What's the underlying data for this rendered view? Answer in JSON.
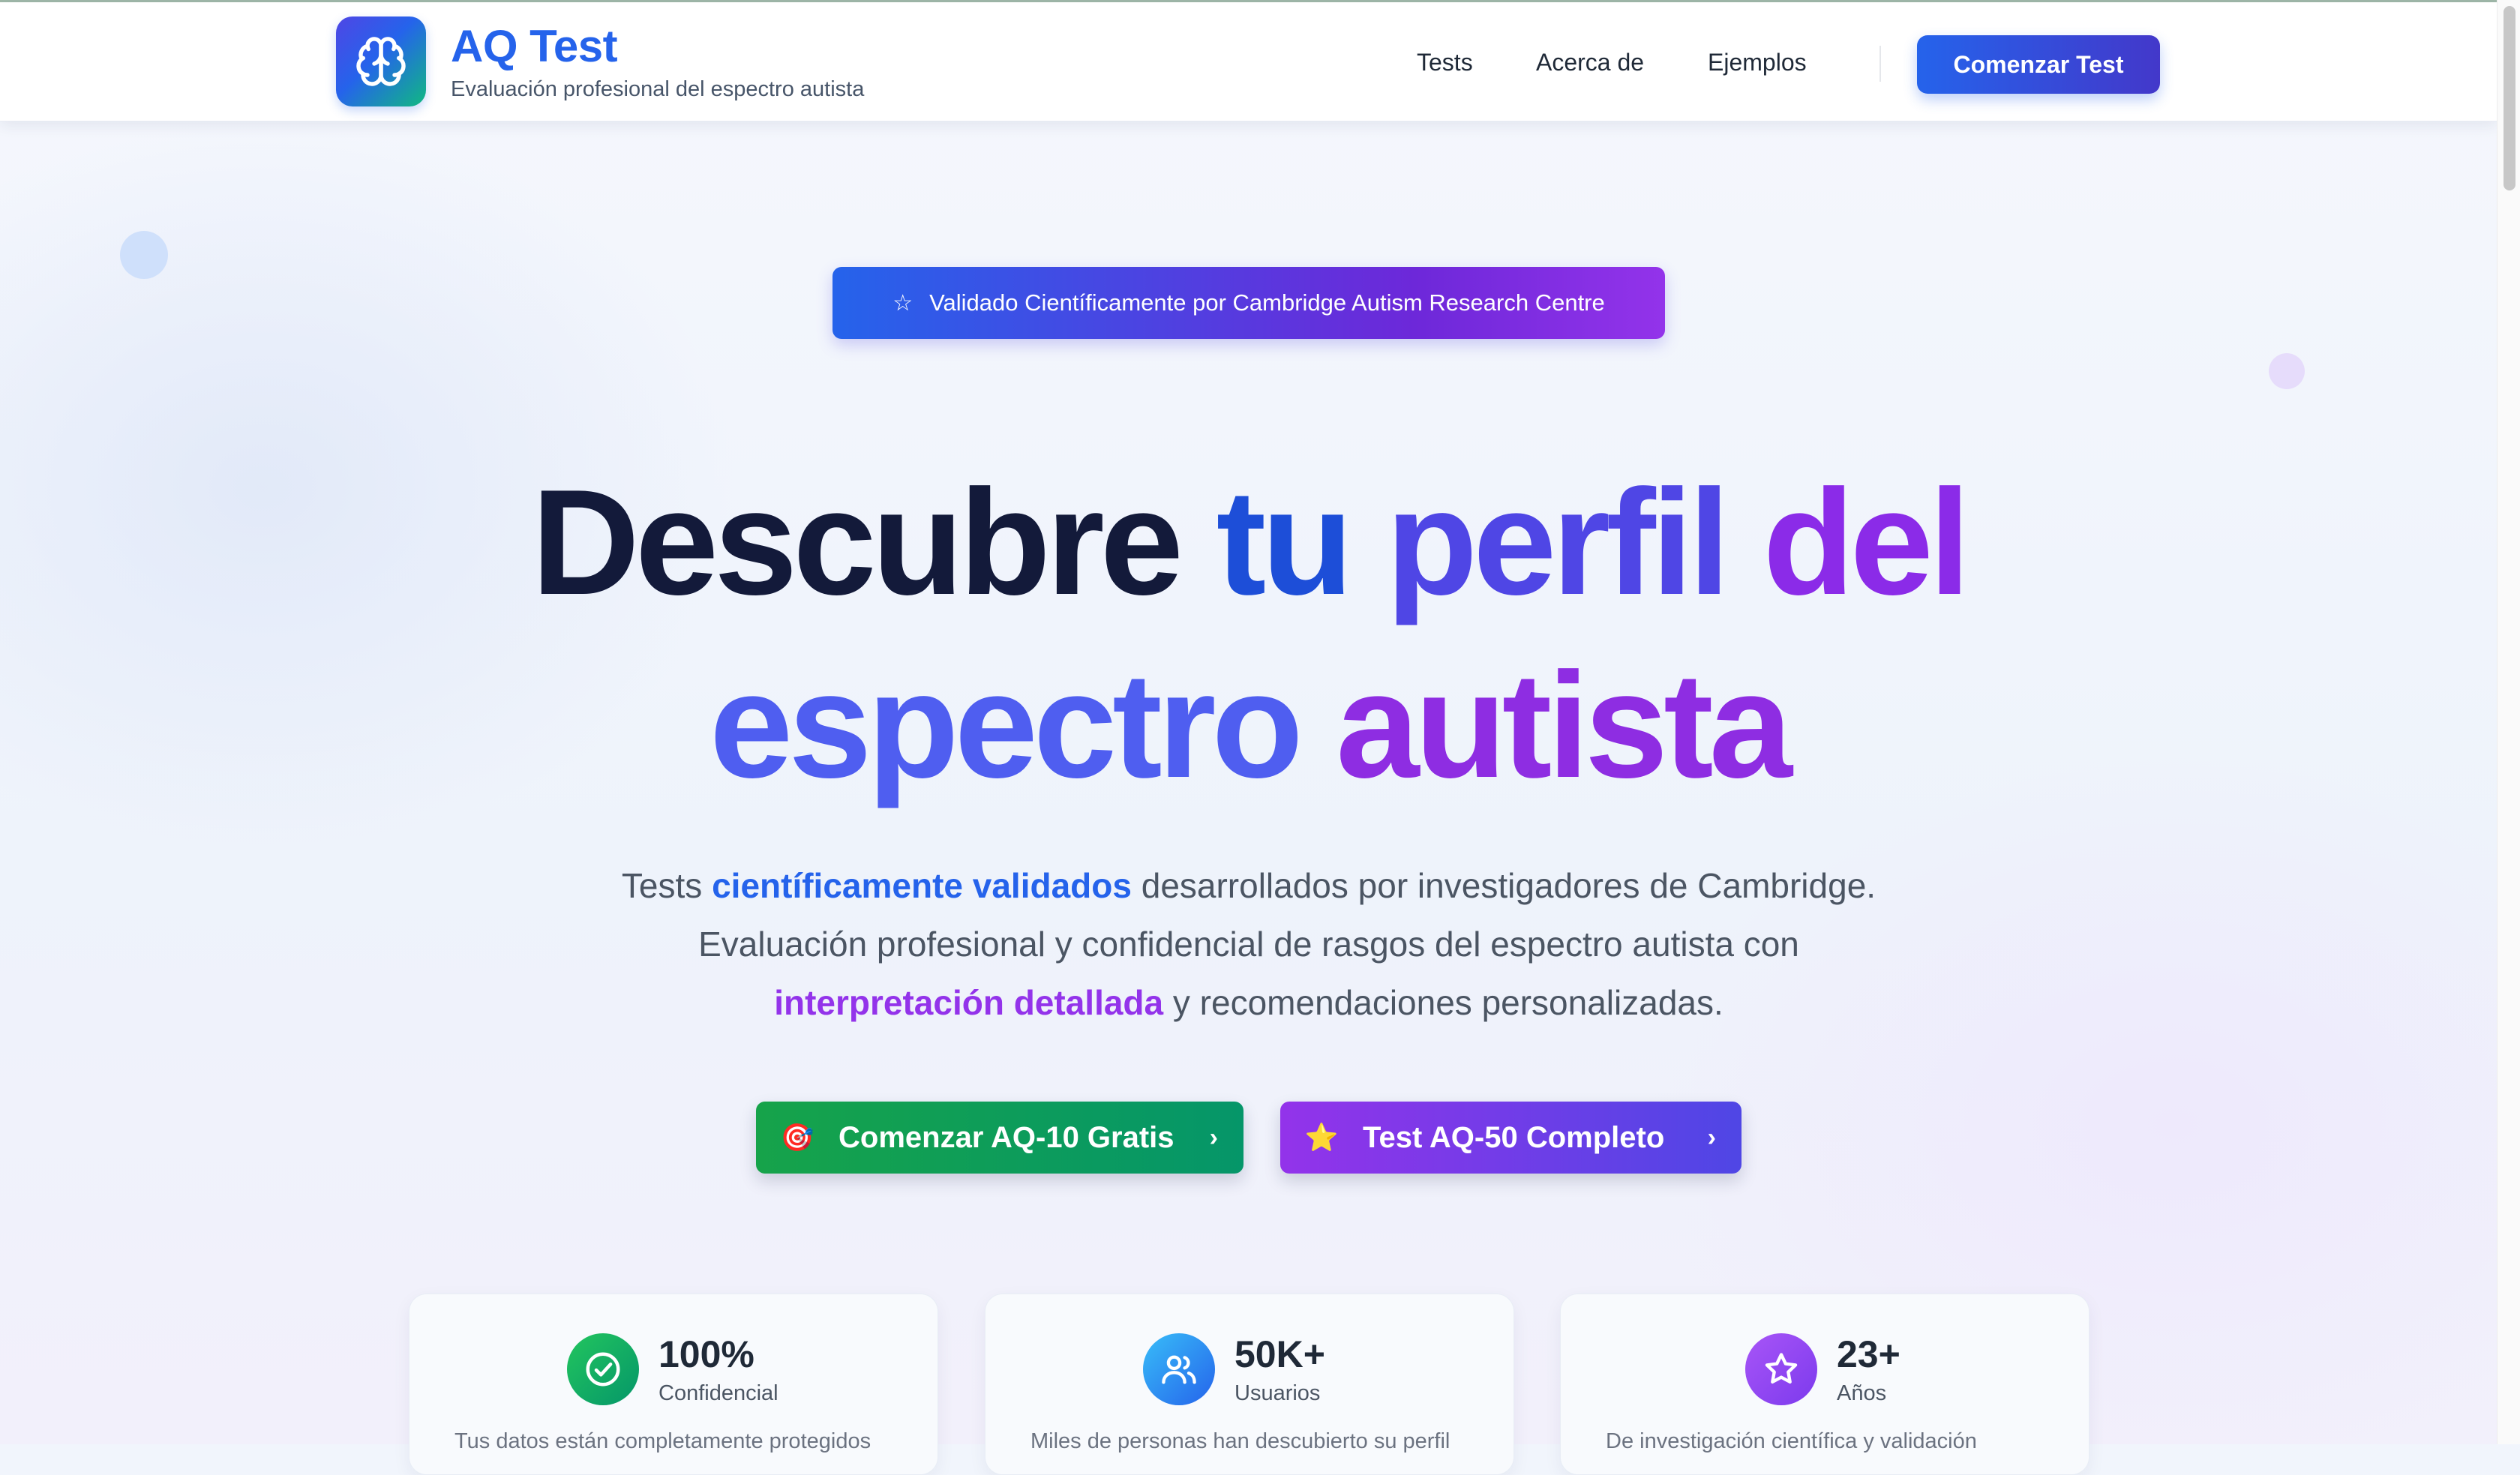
{
  "header": {
    "brand_title": "AQ Test",
    "brand_subtitle": "Evaluación profesional del espectro autista",
    "logo_icon": "brain-icon",
    "nav": [
      {
        "label": "Tests"
      },
      {
        "label": "Acerca de"
      },
      {
        "label": "Ejemplos"
      }
    ],
    "cta_label": "Comenzar Test"
  },
  "hero": {
    "badge_icon": "star-outline-icon",
    "badge_text": "Validado Científicamente por Cambridge Autism Research Centre",
    "title_line1": [
      "Descubre",
      "tu",
      "perfil",
      "del"
    ],
    "title_line2": [
      "espectro",
      "autista"
    ],
    "paragraph": {
      "l1_a": "Tests ",
      "l1_hl": "científicamente validados",
      "l1_b": " desarrollados por investigadores de Cambridge.",
      "l2": "Evaluación profesional y confidencial de rasgos del espectro autista con",
      "l3_hl": "interpretación detallada",
      "l3_b": " y recomendaciones personalizadas."
    },
    "buttons": [
      {
        "emoji": "🎯",
        "label": "Comenzar AQ-10 Gratis",
        "chevron": "›"
      },
      {
        "emoji": "⭐",
        "label": "Test AQ-50 Completo",
        "chevron": "›"
      }
    ]
  },
  "stats": [
    {
      "value": "100%",
      "label": "Confidencial",
      "icon": "check-circle-icon",
      "color": "#16a34a",
      "desc": "Tus datos están completamente protegidos"
    },
    {
      "value": "50K+",
      "label": "Usuarios",
      "icon": "users-icon",
      "color": "#0ea5e9",
      "desc": "Miles de personas han descubierto su perfil"
    },
    {
      "value": "23+",
      "label": "Años",
      "icon": "star-icon",
      "color": "#9333ea",
      "desc": "De investigación científica y validación"
    }
  ],
  "colors": {
    "brand_blue": "#2563eb",
    "brand_purple": "#9333ea",
    "green": "#16a34a"
  }
}
